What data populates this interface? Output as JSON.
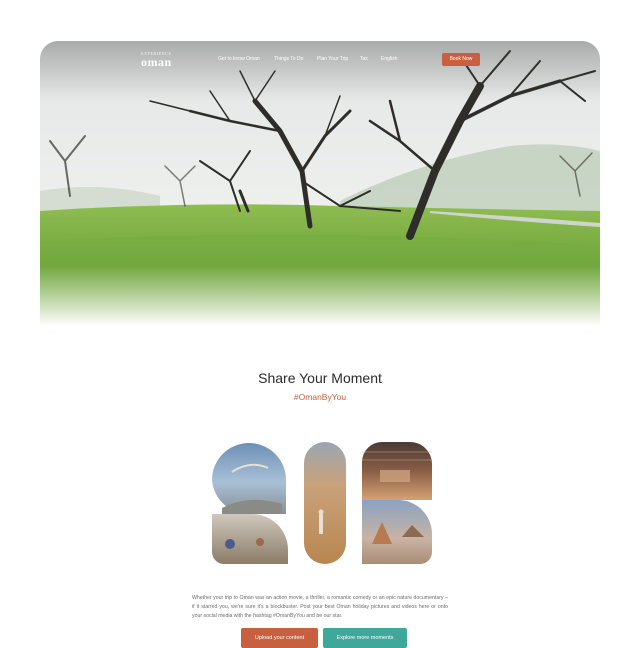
{
  "brand": {
    "top": "EXPERIENCE",
    "name": "oman"
  },
  "nav": {
    "items": [
      "Get to know Oman",
      "Things To Do",
      "Plan Your Trip",
      "Tax",
      "English"
    ],
    "book_label": "Book Now"
  },
  "share": {
    "title": "Share Your Moment",
    "hashtag": "#OmanByYou",
    "description": "Whether your trip to Oman was an action movie, a thriller, a romantic comedy or an epic nature documentary – if it starred you, we're sure it's a blockbuster. Post your best Oman holiday pictures and videos here or onto your social media with the hashtag #OmanByYou and be our star.",
    "upload_label": "Upload your content",
    "explore_label": "Explore more moments"
  },
  "colors": {
    "accent": "#c8603f",
    "teal": "#3ea99a"
  }
}
